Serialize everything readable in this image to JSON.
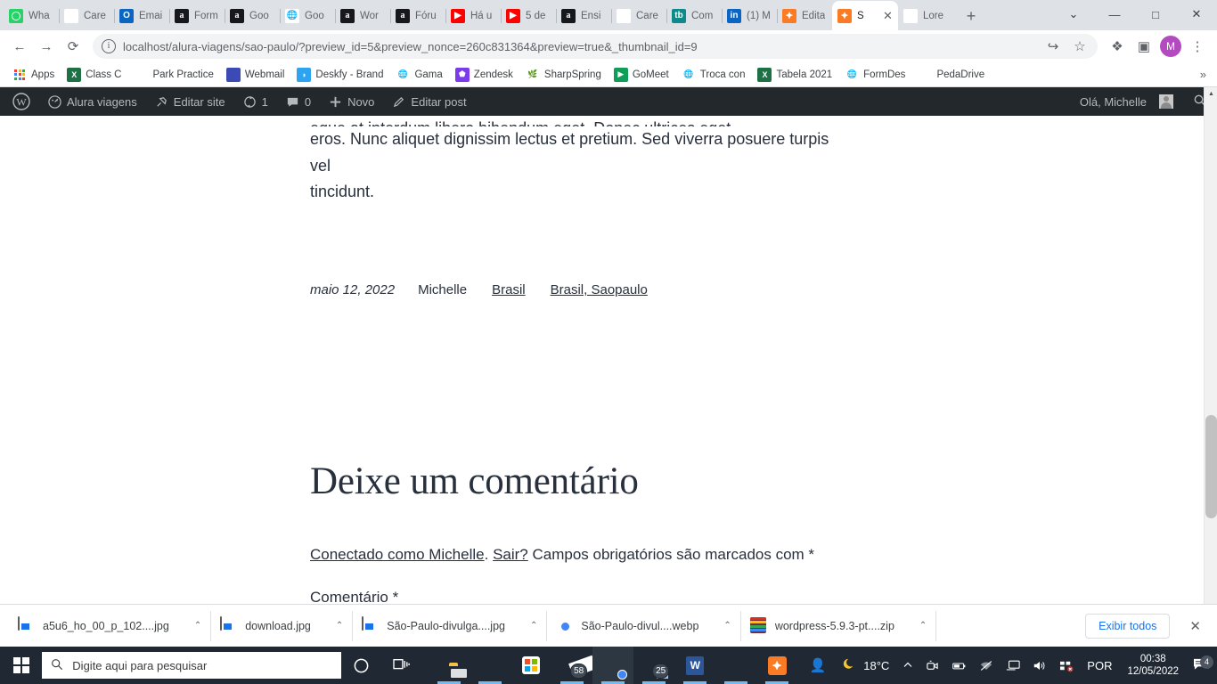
{
  "browser": {
    "tabs": [
      {
        "title": "Wha",
        "icon": "whatsapp-icon",
        "active": false
      },
      {
        "title": "Care",
        "icon": "salesforce-icon",
        "active": false
      },
      {
        "title": "Emai",
        "icon": "outlook-icon",
        "active": false
      },
      {
        "title": "Form",
        "icon": "alura-icon",
        "active": false
      },
      {
        "title": "Goo",
        "icon": "alura-icon",
        "active": false
      },
      {
        "title": "Goo",
        "icon": "globe-icon",
        "active": false
      },
      {
        "title": "Wor",
        "icon": "alura-icon",
        "active": false
      },
      {
        "title": "Fóru",
        "icon": "alura-icon",
        "active": false
      },
      {
        "title": "Há u",
        "icon": "youtube-icon",
        "active": false
      },
      {
        "title": "5 de",
        "icon": "youtube-icon",
        "active": false
      },
      {
        "title": "Ensi",
        "icon": "alura-icon",
        "active": false
      },
      {
        "title": "Care",
        "icon": "salesforce-icon",
        "active": false
      },
      {
        "title": "Com",
        "icon": "teachable-icon",
        "active": false
      },
      {
        "title": "(1) M",
        "icon": "linkedin-icon",
        "active": false
      },
      {
        "title": "Edita",
        "icon": "xampp-icon",
        "active": false
      },
      {
        "title": "S",
        "icon": "xampp-icon",
        "active": true
      },
      {
        "title": "Lore",
        "icon": "lorem-icon",
        "active": false
      }
    ],
    "new_tab_label": "+",
    "window_controls": {
      "minimize": "—",
      "maximize": "□",
      "close": "✕",
      "tab_search": "⌄"
    },
    "toolbar": {
      "back": "←",
      "forward": "→",
      "reload": "⟳",
      "url": "localhost/alura-viagens/sao-paulo/?preview_id=5&preview_nonce=260c831364&preview=true&_thumbnail_id=9",
      "site_info": "i",
      "share": "↪",
      "bookmark": "☆",
      "extensions": "❖",
      "sidepanel": "▣",
      "profile_initial": "M",
      "menu": "⋮"
    },
    "bookmarks": [
      {
        "label": "Apps",
        "icon": "apps-grid-icon"
      },
      {
        "label": "Class C",
        "icon": "excel-icon"
      },
      {
        "label": "Park Practice",
        "icon": "park-icon"
      },
      {
        "label": "Webmail",
        "icon": "webmail-icon"
      },
      {
        "label": "Deskfy - Brand",
        "icon": "deskfy-icon"
      },
      {
        "label": "Gama",
        "icon": "globe-icon"
      },
      {
        "label": "Zendesk",
        "icon": "zendesk-icon"
      },
      {
        "label": "SharpSpring",
        "icon": "sharpspring-icon"
      },
      {
        "label": "GoMeet",
        "icon": "gomeet-icon"
      },
      {
        "label": "Troca con",
        "icon": "globe-icon"
      },
      {
        "label": "Tabela 2021",
        "icon": "excel-icon"
      },
      {
        "label": "FormDes",
        "icon": "globe-icon"
      },
      {
        "label": "PedaDrive",
        "icon": "drive-icon"
      }
    ],
    "bookmarks_overflow": "»"
  },
  "wp_admin_bar": {
    "logo": "wordpress-icon",
    "site_name": "Alura viagens",
    "site_icon": "dashboard-icon",
    "edit_site": "Editar site",
    "edit_site_icon": "customize-icon",
    "updates_count": "1",
    "updates_icon": "update-icon",
    "comments_count": "0",
    "comments_icon": "comment-icon",
    "new_label": "Novo",
    "new_icon": "plus-icon",
    "edit_post": "Editar post",
    "edit_post_icon": "pencil-icon",
    "greeting": "Olá, Michelle",
    "search_icon": "search-icon"
  },
  "post": {
    "body_line_cut": "eque at interdum libero bibendum eget. Donec ultrices eget",
    "body_line_1": "eros. Nunc aliquet dignissim lectus et pretium. Sed viverra posuere turpis vel",
    "body_line_2": "tincidunt.",
    "meta": {
      "date": "maio 12, 2022",
      "author": "Michelle",
      "category": "Brasil",
      "tags": "Brasil, Saopaulo"
    },
    "comments": {
      "heading": "Deixe um comentário",
      "logged_in_prefix": "Conectado como Michelle",
      "logged_in_dot": ".",
      "logout_link": "Sair?",
      "required_note": "Campos obrigatórios são marcados com *",
      "comment_field_label": "Comentário *"
    }
  },
  "downloads": {
    "items": [
      {
        "name": "a5u6_ho_00_p_102....jpg",
        "icon": "image-file-icon",
        "caret": "⌃"
      },
      {
        "name": "download.jpg",
        "icon": "image-file-icon",
        "caret": "⌃"
      },
      {
        "name": "São-Paulo-divulga....jpg",
        "icon": "image-file-icon",
        "caret": "⌃"
      },
      {
        "name": "São-Paulo-divul....webp",
        "icon": "chrome-file-icon",
        "caret": "⌃"
      },
      {
        "name": "wordpress-5.9.3-pt....zip",
        "icon": "winrar-file-icon",
        "caret": "⌃"
      }
    ],
    "show_all": "Exibir todos",
    "close": "✕"
  },
  "taskbar": {
    "start_icon": "windows-start-icon",
    "search_placeholder": "Digite aqui para pesquisar",
    "search_icon": "search-icon",
    "cortana_icon": "cortana-icon",
    "taskview_icon": "task-view-icon",
    "apps": [
      {
        "name": "file-explorer-icon",
        "badge": "",
        "state": "running"
      },
      {
        "name": "edge-icon",
        "badge": "",
        "state": "running"
      },
      {
        "name": "microsoft-store-icon",
        "badge": "",
        "state": "idle"
      },
      {
        "name": "mail-icon",
        "badge": "58",
        "state": "running"
      },
      {
        "name": "chrome-icon",
        "badge": "",
        "state": "active"
      },
      {
        "name": "teams-icon",
        "badge": "25",
        "state": "running"
      },
      {
        "name": "word-icon",
        "badge": "",
        "state": "running"
      },
      {
        "name": "winrar-icon",
        "badge": "",
        "state": "running"
      },
      {
        "name": "xampp-icon",
        "badge": "",
        "state": "running"
      },
      {
        "name": "people-icon",
        "badge": "",
        "state": "idle"
      }
    ],
    "tray": {
      "weather_icon": "moon-icon",
      "temperature": "18°C",
      "expand_icon": "⌃",
      "icons": [
        "camera-icon",
        "battery-icon",
        "wifi-off-icon",
        "display-icon",
        "volume-icon",
        "network-error-icon"
      ],
      "language": "POR",
      "time": "00:38",
      "date": "12/05/2022",
      "notifications_icon": "notifications-icon",
      "notifications_count": "4"
    }
  },
  "colors": {
    "chrome_frame": "#dee1e6",
    "wp_admin_bar": "#23282d",
    "accent_blue": "#1a73e8",
    "taskbar": "#1f2833",
    "xampp_orange": "#fb7a24",
    "text_dark": "#28303d"
  }
}
